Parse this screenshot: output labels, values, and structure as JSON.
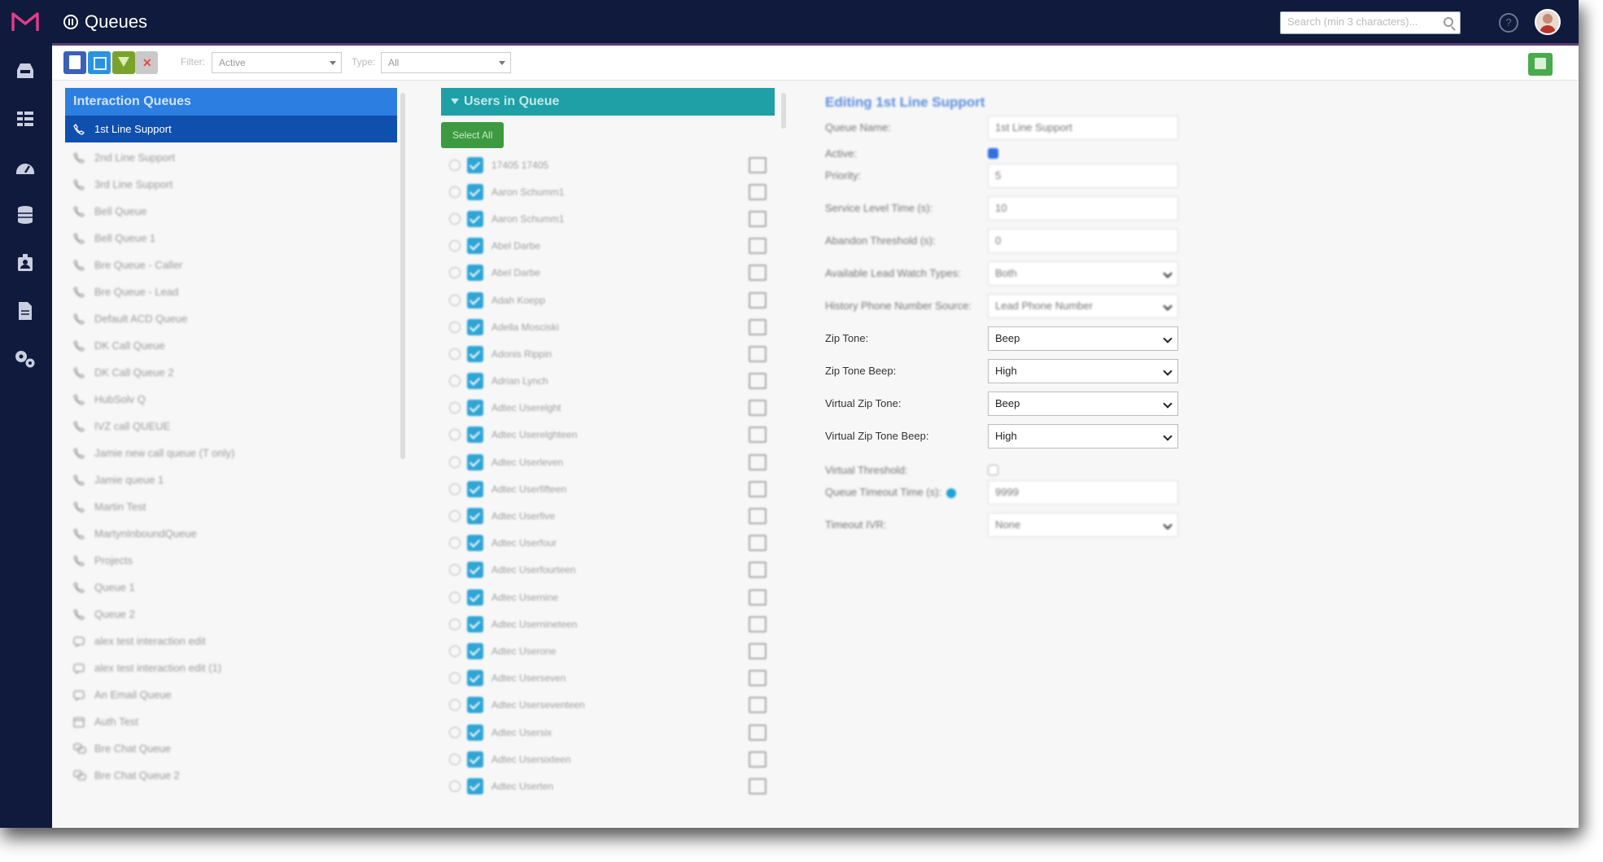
{
  "app": {
    "title": "Queues"
  },
  "header": {
    "search_placeholder": "Search (min 3 characters)...",
    "help_label": "?"
  },
  "sidebar": {
    "icons": [
      "inbox-icon",
      "dashboard-icon",
      "gauge-icon",
      "database-icon",
      "contacts-icon",
      "document-icon",
      "settings-icon"
    ]
  },
  "toolbar": {
    "filter_label": "Filter:",
    "filter_value": "Active",
    "type_label": "Type:",
    "type_value": "All"
  },
  "interaction_queues": {
    "title": "Interaction Queues",
    "items": [
      {
        "label": "1st Line Support",
        "icon": "phone-icon"
      },
      {
        "label": "2nd Line Support",
        "icon": "phone-icon"
      },
      {
        "label": "3rd Line Support",
        "icon": "phone-icon"
      },
      {
        "label": "Bell Queue",
        "icon": "phone-icon"
      },
      {
        "label": "Bell Queue 1",
        "icon": "phone-icon"
      },
      {
        "label": "Bre Queue - Caller",
        "icon": "phone-icon"
      },
      {
        "label": "Bre Queue - Lead",
        "icon": "phone-icon"
      },
      {
        "label": "Default ACD Queue",
        "icon": "phone-icon"
      },
      {
        "label": "DK Call Queue",
        "icon": "phone-icon"
      },
      {
        "label": "DK Call Queue 2",
        "icon": "phone-icon"
      },
      {
        "label": "HubSolv Q",
        "icon": "phone-icon"
      },
      {
        "label": "IVZ call QUEUE",
        "icon": "phone-icon"
      },
      {
        "label": "Jamie new call queue (T only)",
        "icon": "phone-icon"
      },
      {
        "label": "Jamie queue 1",
        "icon": "phone-icon"
      },
      {
        "label": "Martin Test",
        "icon": "phone-icon"
      },
      {
        "label": "MartynInboundQueue",
        "icon": "phone-icon"
      },
      {
        "label": "Projects",
        "icon": "phone-icon"
      },
      {
        "label": "Queue 1",
        "icon": "phone-icon"
      },
      {
        "label": "Queue 2",
        "icon": "phone-icon"
      },
      {
        "label": "alex test interaction edit",
        "icon": "message-icon"
      },
      {
        "label": "alex test interaction edit (1)",
        "icon": "message-icon"
      },
      {
        "label": "An Email Queue",
        "icon": "message-icon"
      },
      {
        "label": "Auth Test",
        "icon": "calendar-icon"
      },
      {
        "label": "Bre Chat Queue",
        "icon": "chat-icon"
      },
      {
        "label": "Bre Chat Queue 2",
        "icon": "chat-icon"
      }
    ]
  },
  "users_in_queue": {
    "title": "Users in Queue",
    "select_all_label": "Select All",
    "users": [
      "17405 17405",
      "Aaron Schumm1",
      "Aaron Schumm1",
      "Abel Darbe",
      "Abel Darbe",
      "Adah Koepp",
      "Adella Mosciski",
      "Adonis Rippin",
      "Adrian Lynch",
      "Adtec Userelght",
      "Adtec Userelghteen",
      "Adtec Userleven",
      "Adtec Userfifteen",
      "Adtec Userfive",
      "Adtec Userfour",
      "Adtec Userfourteen",
      "Adtec Usernine",
      "Adtec Usernineteen",
      "Adtec Userone",
      "Adtec Userseven",
      "Adtec Userseventeen",
      "Adtec Usersix",
      "Adtec Usersixteen",
      "Adtec Userten"
    ]
  },
  "edit_form": {
    "title": "Editing 1st Line Support",
    "queue_name_label": "Queue Name:",
    "queue_name_value": "1st Line Support",
    "active_label": "Active:",
    "priority_label": "Priority:",
    "priority_value": "5",
    "service_level_label": "Service Level Time (s):",
    "service_level_value": "10",
    "abandon_label": "Abandon Threshold (s):",
    "abandon_value": "0",
    "lead_watch_label": "Available Lead Watch Types:",
    "lead_watch_value": "Both",
    "history_phone_label": "History Phone Number Source:",
    "history_phone_value": "Lead Phone Number",
    "zip_tone_label": "Zip Tone:",
    "zip_tone_value": "Beep",
    "zip_tone_beep_label": "Zip Tone Beep:",
    "zip_tone_beep_value": "High",
    "virtual_zip_tone_label": "Virtual Zip Tone:",
    "virtual_zip_tone_value": "Beep",
    "virtual_zip_tone_beep_label": "Virtual Zip Tone Beep:",
    "virtual_zip_tone_beep_value": "High",
    "virtual_threshold_label": "Virtual Threshold:",
    "queue_timeout_label": "Queue Timeout Time (s):",
    "queue_timeout_value": "9999",
    "timeout_ivr_label": "Timeout IVR:",
    "timeout_ivr_value": "None"
  },
  "colors": {
    "topbar": "#0f1a3c",
    "iq_header": "#2c7fe0",
    "uq_header": "#1fa0a6",
    "active_item": "#0f4fae",
    "select_all": "#3d9a40"
  }
}
